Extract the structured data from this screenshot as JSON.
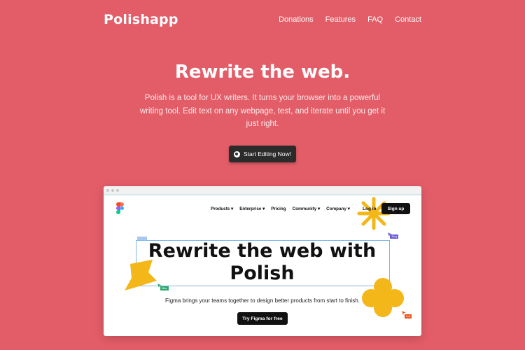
{
  "header": {
    "brand": "Polishapp",
    "nav": [
      "Donations",
      "Features",
      "FAQ",
      "Contact"
    ]
  },
  "hero": {
    "title": "Rewrite the web.",
    "subtitle": "Polish is a tool for UX writers. It turns your browser into a powerful writing tool. Edit text on any webpage, test, and iterate until you get it just right.",
    "cta_label": "Start Editing Now!"
  },
  "preview": {
    "nav": [
      "Products ▾",
      "Enterprise ▾",
      "Pricing",
      "Community ▾",
      "Company ▾"
    ],
    "login": "Log in",
    "signup": "Sign up",
    "headline": "Rewrite the web with Polish",
    "subline": "Figma brings your teams together to design better products from start to finish.",
    "button": "Try Figma for free",
    "cursor_tags": [
      "Tony",
      "Max",
      "Luk"
    ]
  },
  "colors": {
    "background": "#e35d68",
    "button_dark": "#2b2b2b",
    "accent_yellow": "#f4b71a"
  }
}
